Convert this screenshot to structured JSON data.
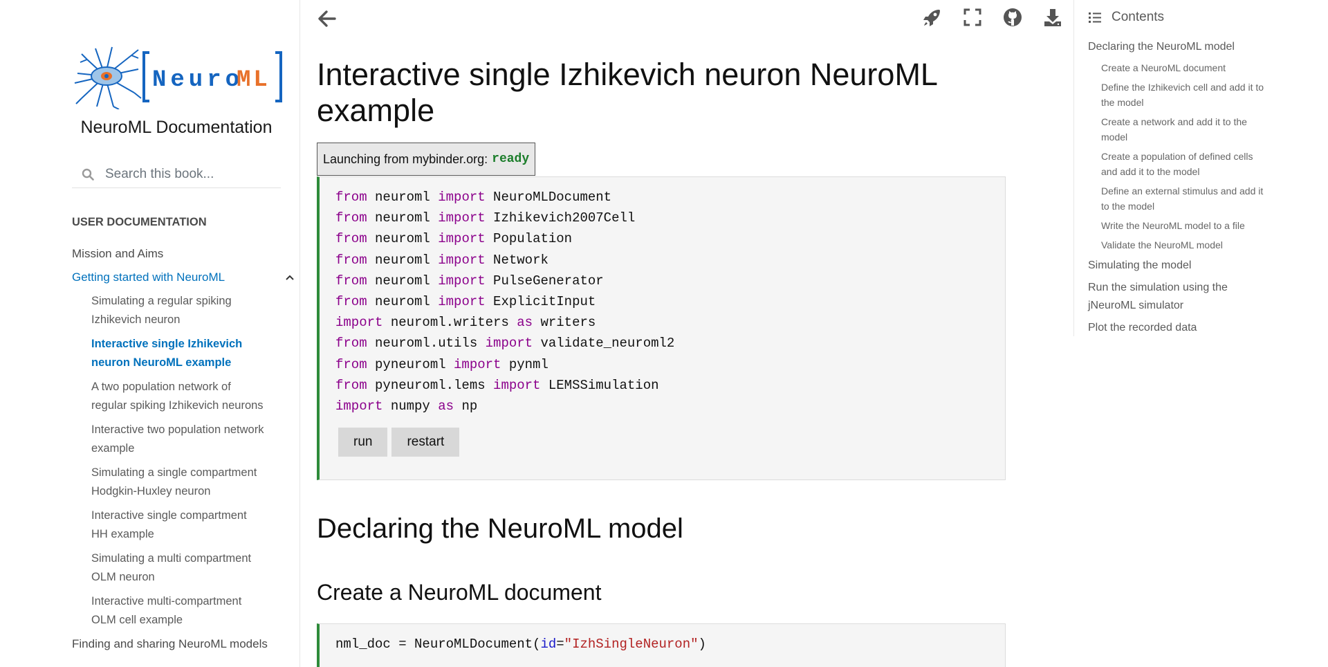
{
  "sidebar": {
    "site_title": "NeuroML Documentation",
    "logo_text": "[NeuroML]",
    "search_placeholder": "Search this book...",
    "caption": "USER DOCUMENTATION",
    "items": [
      {
        "label": "Mission and Aims"
      },
      {
        "label": "Getting started with NeuroML",
        "active": true
      },
      {
        "label": "Finding and sharing NeuroML models"
      }
    ],
    "subitems": [
      {
        "label": "Simulating a regular spiking Izhikevich neuron"
      },
      {
        "label": "Interactive single Izhikevich neuron NeuroML example",
        "active": true
      },
      {
        "label": "A two population network of regular spiking Izhikevich neurons"
      },
      {
        "label": "Interactive two population network example"
      },
      {
        "label": "Simulating a single compartment Hodgkin-Huxley neuron"
      },
      {
        "label": "Interactive single compartment HH example"
      },
      {
        "label": "Simulating a multi compartment OLM neuron"
      },
      {
        "label": "Interactive multi-compartment OLM cell example"
      }
    ]
  },
  "topbar": {
    "icons": [
      "arrow-left-icon",
      "rocket-icon",
      "fullscreen-icon",
      "github-icon",
      "download-icon"
    ]
  },
  "main": {
    "title": "Interactive single Izhikevich neuron NeuroML example",
    "status_prefix": "Launching from mybinder.org:",
    "status_value": "ready",
    "code_lines": [
      [
        "from",
        " neuroml ",
        "import",
        " NeuroMLDocument"
      ],
      [
        "from",
        " neuroml ",
        "import",
        " Izhikevich2007Cell"
      ],
      [
        "from",
        " neuroml ",
        "import",
        " Population"
      ],
      [
        "from",
        " neuroml ",
        "import",
        " Network"
      ],
      [
        "from",
        " neuroml ",
        "import",
        " PulseGenerator"
      ],
      [
        "from",
        " neuroml ",
        "import",
        " ExplicitInput"
      ],
      [
        "import",
        " neuroml.writers ",
        "as",
        " writers"
      ],
      [
        "from",
        " neuroml.utils ",
        "import",
        " validate_neuroml2"
      ],
      [
        "from",
        " pyneuroml ",
        "import",
        " pynml"
      ],
      [
        "from",
        " pyneuroml.lems ",
        "import",
        " LEMSSimulation"
      ],
      [
        "import",
        " numpy ",
        "as",
        " np"
      ]
    ],
    "run_label": "run",
    "restart_label": "restart",
    "section_h2": "Declaring the NeuroML model",
    "section_h3": "Create a NeuroML document",
    "code2": {
      "prefix": "nml_doc = NeuroMLDocument(",
      "param": "id",
      "eq": "=",
      "string": "\"IzhSingleNeuron\"",
      "suffix": ")"
    }
  },
  "toc": {
    "header": "Contents",
    "items": [
      {
        "label": "Declaring the NeuroML model",
        "level": 1
      },
      {
        "label": "Create a NeuroML document",
        "level": 2
      },
      {
        "label": "Define the Izhikevich cell and add it to the model",
        "level": 2
      },
      {
        "label": "Create a network and add it to the model",
        "level": 2
      },
      {
        "label": "Create a population of defined cells and add it to the model",
        "level": 2
      },
      {
        "label": "Define an external stimulus and add it to the model",
        "level": 2
      },
      {
        "label": "Write the NeuroML model to a file",
        "level": 2
      },
      {
        "label": "Validate the NeuroML model",
        "level": 2
      },
      {
        "label": "Simulating the model",
        "level": 1
      },
      {
        "label": "Run the simulation using the jNeuroML simulator",
        "level": 1
      },
      {
        "label": "Plot the recorded data",
        "level": 1
      }
    ]
  },
  "colors": {
    "accent": "#0071bc",
    "keyword": "#8b008b",
    "ready": "#1b7d2a",
    "cell_border": "#2e8b3a",
    "logo_blue": "#1565c0",
    "logo_orange": "#e8712a"
  }
}
